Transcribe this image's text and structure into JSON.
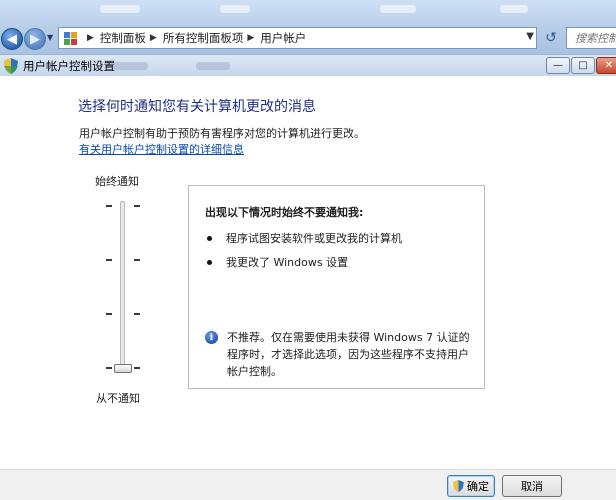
{
  "explorer": {
    "breadcrumbs": [
      "控制面板",
      "所有控制面板项",
      "用户帐户"
    ],
    "search_placeholder": "搜索控制"
  },
  "dialog": {
    "title": "用户帐户控制设置",
    "heading": "选择何时通知您有关计算机更改的消息",
    "description": "用户帐户控制有助于预防有害程序对您的计算机进行更改。",
    "help_link": "有关用户帐户控制设置的详细信息",
    "slider": {
      "top_label": "始终通知",
      "bottom_label": "从不通知",
      "levels": 4,
      "selected_level": 1
    },
    "panel": {
      "title": "出现以下情况时始终不要通知我:",
      "bullets": [
        "程序试图安装软件或更改我的计算机",
        "我更改了 Windows 设置"
      ],
      "note": "不推荐。仅在需要使用未获得 Windows 7 认证的程序时，才选择此选项，因为这些程序不支持用户帐户控制。"
    },
    "buttons": {
      "ok": "确定",
      "cancel": "取消"
    }
  },
  "colors": {
    "heading": "#1e3287",
    "link": "#0a48b0",
    "chrome": "#b4cbe6"
  }
}
